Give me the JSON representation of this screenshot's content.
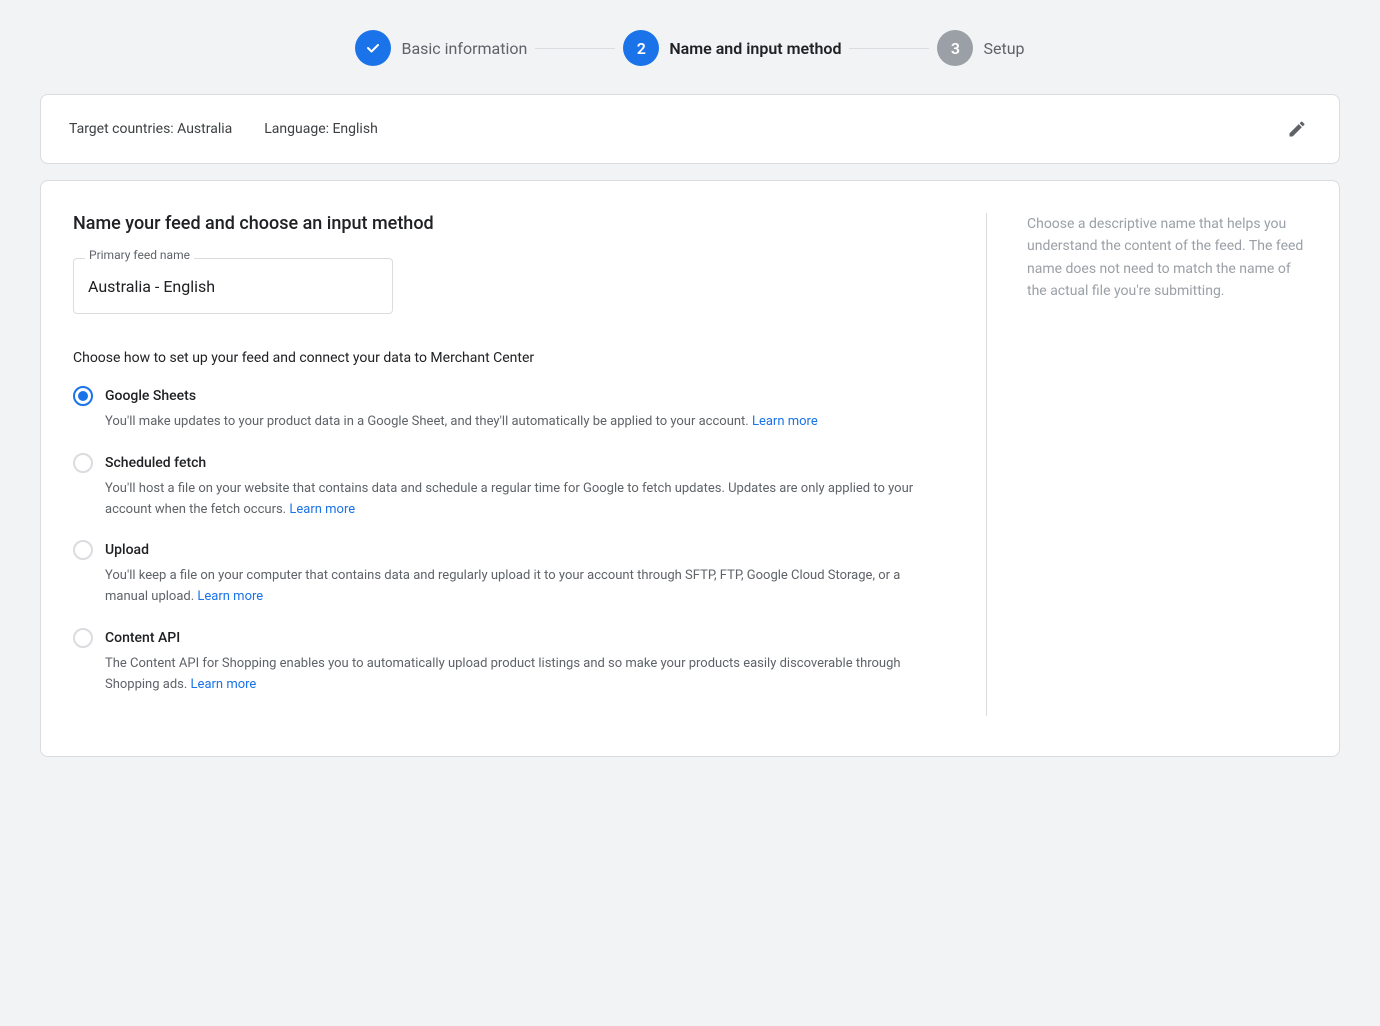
{
  "stepper": {
    "steps": [
      {
        "id": "basic-info",
        "number": "✓",
        "label": "Basic information",
        "state": "completed"
      },
      {
        "id": "name-input",
        "number": "2",
        "label": "Name and input method",
        "state": "active"
      },
      {
        "id": "setup",
        "number": "3",
        "label": "Setup",
        "state": "inactive"
      }
    ]
  },
  "summary_card": {
    "target_countries_label": "Target countries: Australia",
    "language_label": "Language: English",
    "edit_tooltip": "Edit"
  },
  "main": {
    "section_title": "Name your feed and choose an input method",
    "feed_name_label": "Primary feed name",
    "feed_name_value": "Australia - English",
    "right_description": "Choose a descriptive name that helps you understand the content of the feed. The feed name does not need to match the name of the actual file you're submitting.",
    "feed_method_title": "Choose how to set up your feed and connect your data to Merchant Center",
    "methods": [
      {
        "id": "google-sheets",
        "label": "Google Sheets",
        "selected": true,
        "description": "You'll make updates to your product data in a Google Sheet, and they'll automatically be applied to your account.",
        "learn_more_text": "Learn more",
        "learn_more_href": "#"
      },
      {
        "id": "scheduled-fetch",
        "label": "Scheduled fetch",
        "selected": false,
        "description": "You'll host a file on your website that contains data and schedule a regular time for Google to fetch updates. Updates are only applied to your account when the fetch occurs.",
        "learn_more_text": "Learn more",
        "learn_more_href": "#"
      },
      {
        "id": "upload",
        "label": "Upload",
        "selected": false,
        "description": "You'll keep a file on your computer that contains data and regularly upload it to your account through SFTP, FTP, Google Cloud Storage, or a manual upload.",
        "learn_more_text": "Learn more",
        "learn_more_href": "#"
      },
      {
        "id": "content-api",
        "label": "Content API",
        "selected": false,
        "description": "The Content API for Shopping enables you to automatically upload product listings and so make your products easily discoverable through Shopping ads.",
        "learn_more_text": "Learn more",
        "learn_more_href": "#"
      }
    ]
  }
}
